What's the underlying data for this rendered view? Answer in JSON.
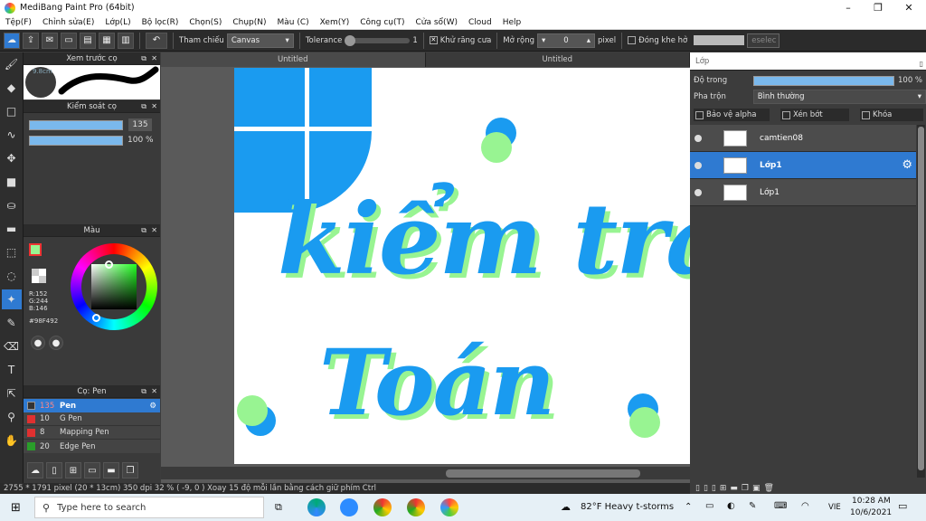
{
  "window": {
    "title": "MediBang Paint Pro (64bit)"
  },
  "menu": [
    "Tệp(F)",
    "Chỉnh sửa(E)",
    "Lớp(L)",
    "Bộ lọc(R)",
    "Chọn(S)",
    "Chụp(N)",
    "Màu (C)",
    "Xem(Y)",
    "Công cụ(T)",
    "Cửa sổ(W)",
    "Cloud",
    "Help"
  ],
  "toolbar": {
    "reference_label": "Tham chiếu",
    "reference_value": "Canvas",
    "tolerance_label": "Tolerance",
    "tolerance_value": "1",
    "antialias_label": "Khử răng cưa",
    "expand_label": "Mở rộng",
    "expand_value": "0",
    "expand_unit": "pixel",
    "close_gap_label": "Đóng khe hở",
    "eselect_label": "eselec"
  },
  "panels": {
    "preview": {
      "title": "Xem trước cọ",
      "size": "9.8cm"
    },
    "brush_control": {
      "title": "Kiểm soát cọ",
      "size_value": "135",
      "opacity_value": "100 %"
    },
    "color": {
      "title": "Màu",
      "r": "R:152",
      "g": "G:244",
      "b": "B:146",
      "hex": "#98F492"
    },
    "brush": {
      "title": "Cọ: Pen",
      "items": [
        {
          "size": "135",
          "name": "Pen",
          "color": "#333333"
        },
        {
          "size": "10",
          "name": "G Pen",
          "color": "#e03030"
        },
        {
          "size": "8",
          "name": "Mapping Pen",
          "color": "#e03030"
        },
        {
          "size": "20",
          "name": "Edge Pen",
          "color": "#2a9e2a"
        }
      ]
    }
  },
  "tabs": [
    "Untitled",
    "Untitled"
  ],
  "canvas_text": {
    "line1": "kiểm tra",
    "line2": "Toán"
  },
  "layers_panel": {
    "title": "Lớp",
    "opacity_label": "Độ trong",
    "opacity_value": "100 %",
    "blend_label": "Pha trộn",
    "blend_value": "Bình thường",
    "protect_alpha_label": "Bảo vệ alpha",
    "clip_label": "Xén bớt",
    "lock_label": "Khóa",
    "layers": [
      {
        "name": "camtien08"
      },
      {
        "name": "Lớp1"
      },
      {
        "name": "Lớp1"
      }
    ]
  },
  "status": {
    "text": "2755 * 1791 pixel   (20 * 13cm)   350 dpi   32 %   ( -9, 0 )   Xoay 15 độ mỗi lần bằng cách giữ phím Ctrl"
  },
  "taskbar": {
    "search_placeholder": "Type here to search",
    "weather": "82°F  Heavy t-storms",
    "lang": "VIE",
    "time": "10:28 AM",
    "date": "10/6/2021"
  },
  "colors": {
    "accent": "#2f7ad1",
    "ink_blue": "#1da1f2",
    "ink_green": "#98f492"
  }
}
